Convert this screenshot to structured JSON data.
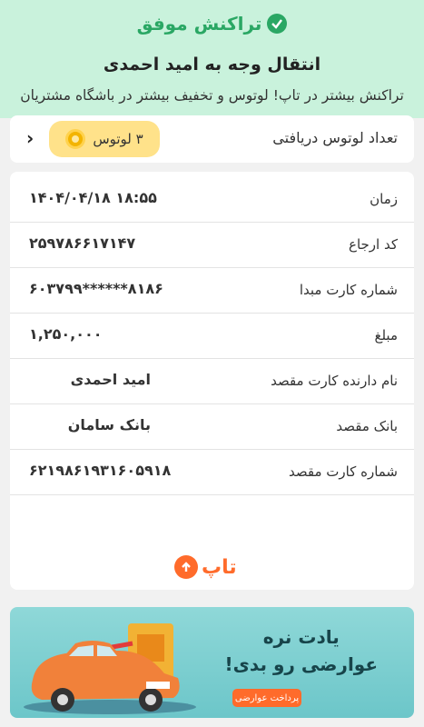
{
  "header": {
    "status": "تراکنش موفق",
    "title": "انتقال وجه به امید احمدی",
    "promo": "تراکنش بیشتر در تاپ! لوتوس و تخفیف بیشتر در باشگاه مشتریان"
  },
  "lotus": {
    "label": "تعداد لوتوس دریافتی",
    "value": "۳ لوتوس"
  },
  "details": [
    {
      "label": "زمان",
      "value": "۱۴۰۴/۰۴/۱۸ ۱۸:۵۵"
    },
    {
      "label": "کد ارجاع",
      "value": "۲۵۹۷۸۶۶۱۷۱۴۷"
    },
    {
      "label": "شماره کارت مبدا",
      "value": "۶۰۳۷۹۹******۸۱۸۶"
    },
    {
      "label": "مبلغ",
      "value": "۱,۲۵۰,۰۰۰"
    },
    {
      "label": "نام دارنده کارت مقصد",
      "value": "امید احمدی"
    },
    {
      "label": "بانک مقصد",
      "value": "بانک سامان"
    },
    {
      "label": "شماره کارت مقصد",
      "value": "۶۲۱۹۸۶۱۹۳۱۶۰۵۹۱۸"
    }
  ],
  "brand": {
    "name": "تاپ"
  },
  "banner": {
    "line1": "یادت نره",
    "line2": "عوارضی رو بدی!",
    "button": "پرداخت عوارضی"
  }
}
